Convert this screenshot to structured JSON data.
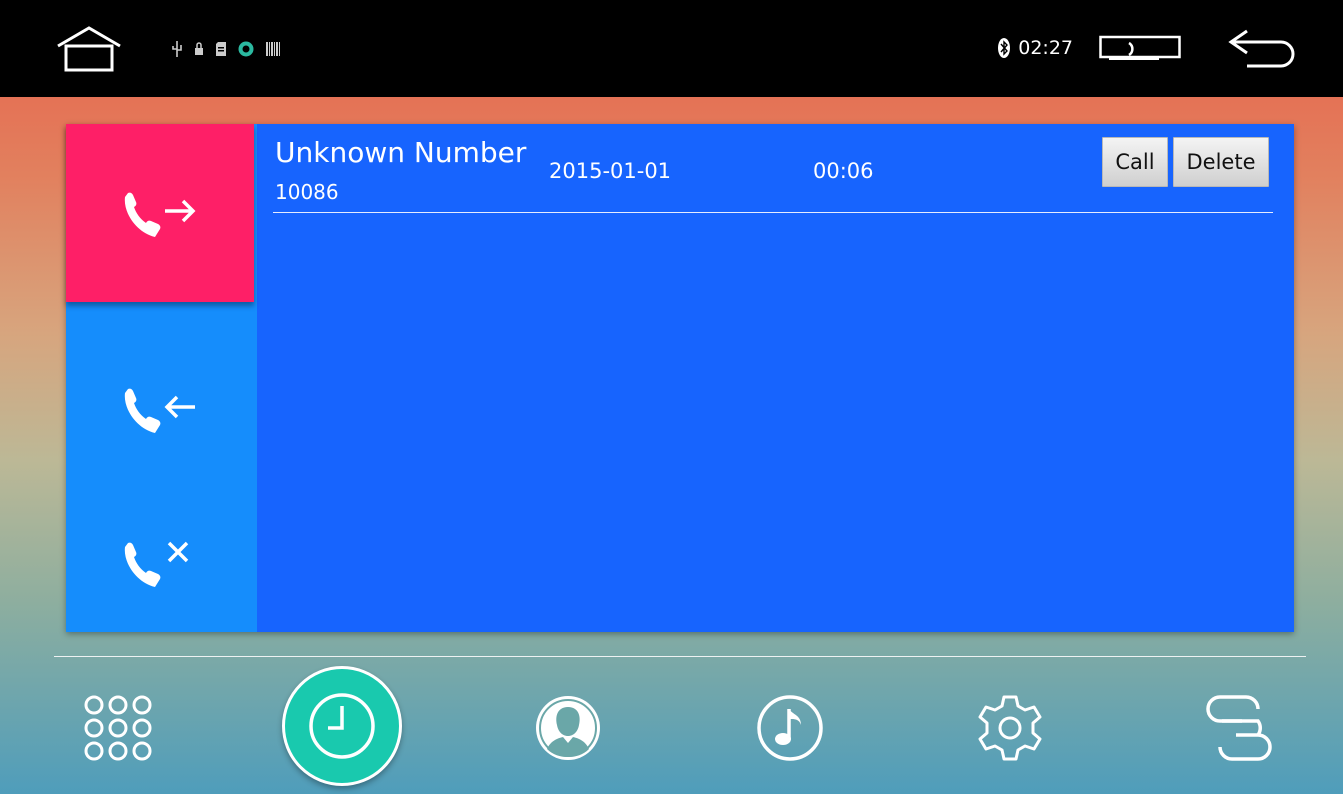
{
  "status_bar": {
    "time": "02:27",
    "icons": [
      "home-outline-icon",
      "usb-icon",
      "lock-icon",
      "sd-card-icon",
      "android-icon",
      "barcode-icon",
      "bluetooth-icon",
      "screen-icon",
      "back-arrow-icon"
    ]
  },
  "call_tabs": [
    {
      "id": "outgoing",
      "icon": "outgoing-call-icon",
      "selected": true
    },
    {
      "id": "incoming",
      "icon": "incoming-call-icon",
      "selected": false
    },
    {
      "id": "missed",
      "icon": "missed-call-icon",
      "selected": false
    }
  ],
  "call_log": {
    "rows": [
      {
        "name": "Unknown Number",
        "number": "10086",
        "date": "2015-01-01",
        "duration": "00:06"
      }
    ],
    "call_label": "Call",
    "delete_label": "Delete"
  },
  "bottom_nav": [
    {
      "id": "dialpad",
      "icon": "dialpad-icon"
    },
    {
      "id": "recent",
      "icon": "clock-icon",
      "selected": true
    },
    {
      "id": "contacts",
      "icon": "contact-icon"
    },
    {
      "id": "music",
      "icon": "music-note-icon"
    },
    {
      "id": "settings",
      "icon": "gear-icon"
    },
    {
      "id": "link",
      "icon": "link-icon"
    }
  ],
  "colors": {
    "status_bar": "#000000",
    "panel": "#1764fe",
    "tab_column": "#158dfc",
    "tab_selected": "#fe1f67",
    "recent_active": "#19c9ae"
  }
}
